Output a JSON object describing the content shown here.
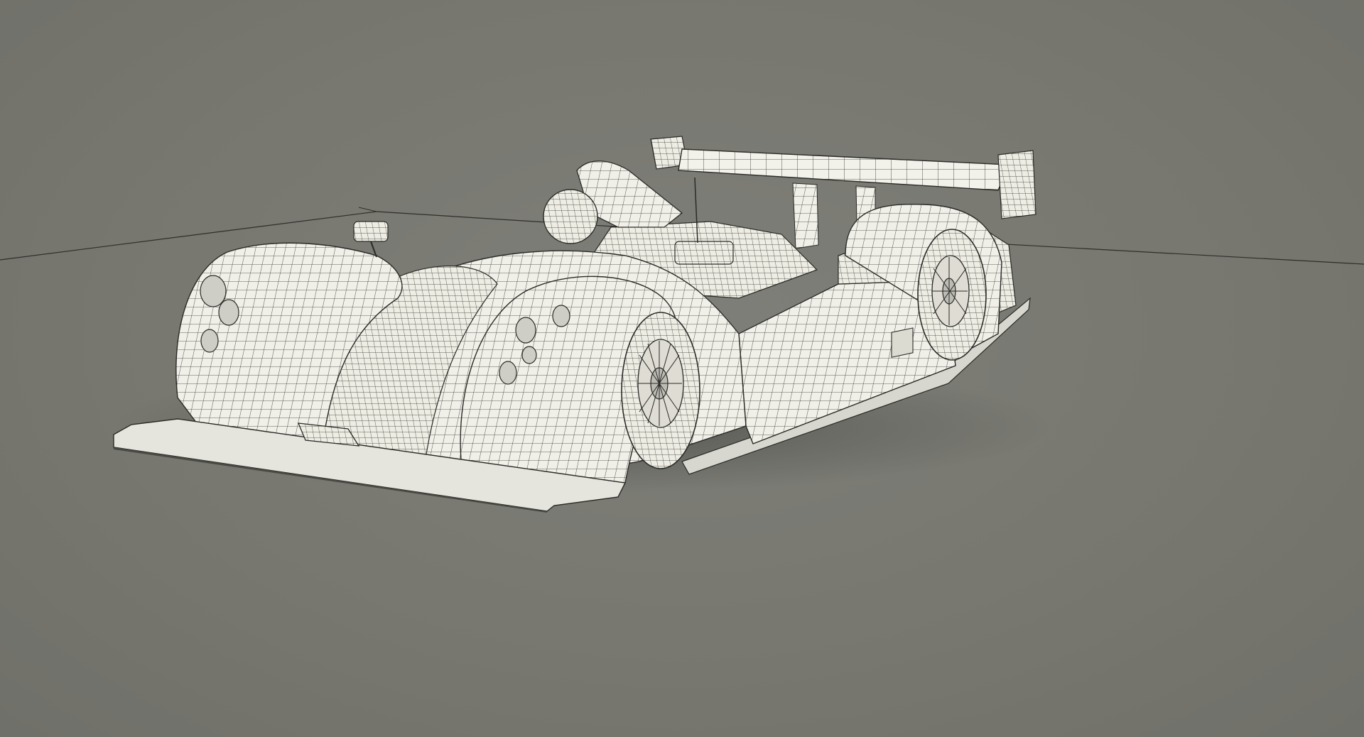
{
  "viewport": {
    "background_color": "#7a7a75",
    "ground_line_color": "#2e2e2b",
    "model_fill_color": "#f1f0e8",
    "wire_color": "#2a2a27",
    "shadow_color": "#3a3a36"
  },
  "model": {
    "subject": "le-mans-prototype-race-car",
    "display_mode": "wireframe-on-shaded"
  }
}
